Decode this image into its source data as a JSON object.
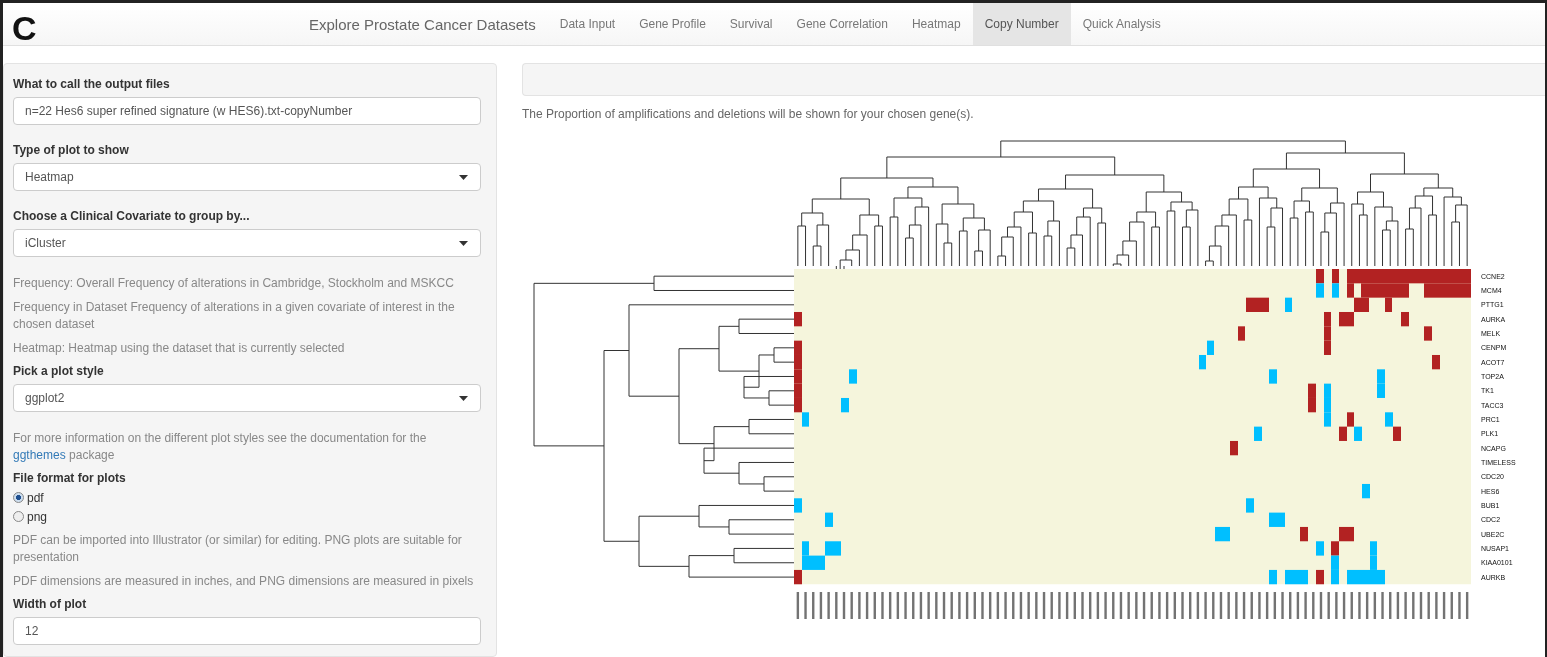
{
  "panel_label": "C",
  "navbar": {
    "brand": "Explore Prostate Cancer Datasets",
    "tabs": [
      {
        "label": "Data Input",
        "selected": false
      },
      {
        "label": "Gene Profile",
        "selected": false
      },
      {
        "label": "Survival",
        "selected": false
      },
      {
        "label": "Gene Correlation",
        "selected": false
      },
      {
        "label": "Heatmap",
        "selected": false
      },
      {
        "label": "Copy Number",
        "selected": true
      },
      {
        "label": "Quick Analysis",
        "selected": false
      }
    ]
  },
  "sidebar": {
    "items": [
      {
        "kind": "text_input",
        "label": "What to call the output files",
        "value": "n=22 Hes6 super refined signature (w HES6).txt-copyNumber"
      },
      {
        "kind": "select",
        "label": "Type of plot to show",
        "value": "Heatmap"
      },
      {
        "kind": "select",
        "label": "Choose a Clinical Covariate to group by...",
        "value": "iCluster"
      },
      {
        "kind": "help",
        "text": "Frequency: Overall Frequency of alterations in Cambridge, Stockholm and MSKCC"
      },
      {
        "kind": "help",
        "text": "Frequency in Dataset Frequency of alterations in a given covariate of interest in the chosen dataset"
      },
      {
        "kind": "help",
        "text": "Heatmap: Heatmap using the dataset that is currently selected"
      },
      {
        "kind": "select",
        "label": "Pick a plot style",
        "value": "ggplot2"
      },
      {
        "kind": "help_link",
        "text": "For more information on the different plot styles see the documentation for the",
        "link": "ggthemes",
        "after": "package"
      },
      {
        "kind": "radio",
        "label": "File format for plots",
        "options": [
          {
            "label": "pdf",
            "selected": true
          },
          {
            "label": "png",
            "selected": false
          }
        ]
      },
      {
        "kind": "help",
        "text": "PDF can be imported into Illustrator (or similar) for editing. PNG plots are suitable for presentation"
      },
      {
        "kind": "help",
        "text": "PDF dimensions are measured in inches, and PNG dimensions are measured in pixels"
      },
      {
        "kind": "text_input",
        "label": "Width of plot",
        "value": "12"
      }
    ]
  },
  "main": {
    "note": "The Proportion of amplifications and deletions will be shown for your chosen gene(s).",
    "heatmap": {
      "genes": [
        "CCNE2",
        "MCM4",
        "PTTG1",
        "AURKA",
        "MELK",
        "CENPM",
        "ACOT7",
        "TOP2A",
        "TK1",
        "TACC3",
        "PRC1",
        "PLK1",
        "NCAPG",
        "TIMELESS",
        "CDC20",
        "HES6",
        "BUB1",
        "CDC2",
        "UBE2C",
        "NUSAP1",
        "KIAA0101",
        "AURKB"
      ]
    }
  }
}
